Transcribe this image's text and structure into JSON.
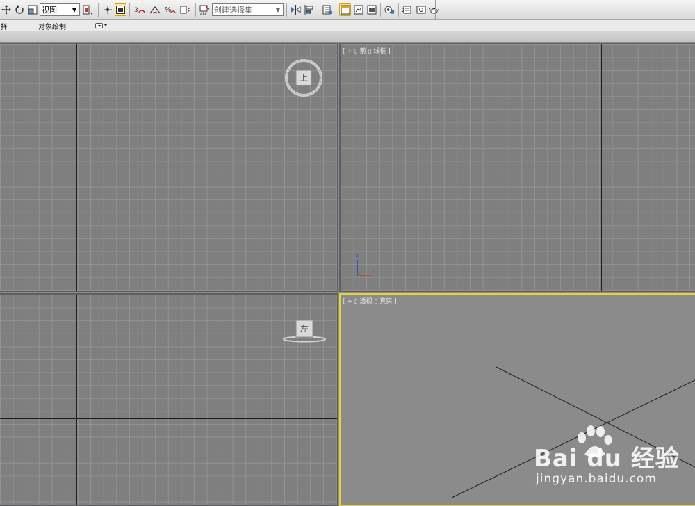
{
  "toolbar": {
    "view_dropdown": "视图",
    "selection_set_placeholder": "创建选择集"
  },
  "ribbon": {
    "left_label": "择",
    "object_paint_label": "对象绘制"
  },
  "viewports": {
    "top": {
      "gizmo_label": "上"
    },
    "front": {
      "label": "[ + ▯ 前 ▯ 线框 ]",
      "axis_z": "z",
      "axis_x": "x"
    },
    "left": {
      "gizmo_label": "左"
    },
    "perspective": {
      "label": "[ + ▯ 透视 ▯ 真实 ]",
      "active": true
    }
  },
  "watermark": {
    "brand": "Bai du 经验",
    "url": "jingyan.baidu.com"
  },
  "colors": {
    "viewport_bg": "#7f7f7f",
    "grid": "#939393",
    "active_border": "#e6d33c",
    "toolbar_bg": "#e4e4e4"
  }
}
